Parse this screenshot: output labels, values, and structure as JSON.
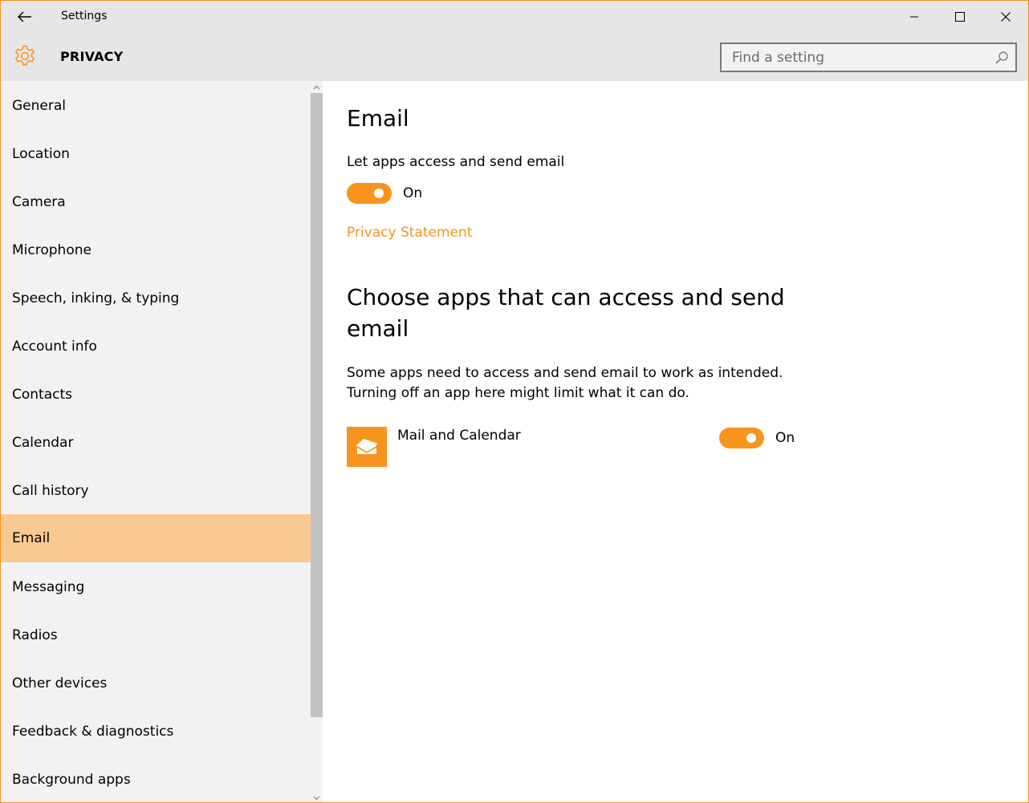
{
  "window": {
    "title": "Settings",
    "border_color": "#f7941d"
  },
  "title_bar": {
    "back_icon": "back-arrow-icon",
    "minimize_icon": "minimize-icon",
    "maximize_icon": "maximize-icon",
    "close_icon": "close-icon"
  },
  "header": {
    "icon": "gear-icon",
    "title": "PRIVACY",
    "search": {
      "placeholder": "Find a setting",
      "value": "",
      "icon": "search-icon"
    }
  },
  "sidebar": {
    "selected_index": 9,
    "items": [
      {
        "label": "General"
      },
      {
        "label": "Location"
      },
      {
        "label": "Camera"
      },
      {
        "label": "Microphone"
      },
      {
        "label": "Speech, inking, & typing"
      },
      {
        "label": "Account info"
      },
      {
        "label": "Contacts"
      },
      {
        "label": "Calendar"
      },
      {
        "label": "Call history"
      },
      {
        "label": "Email"
      },
      {
        "label": "Messaging"
      },
      {
        "label": "Radios"
      },
      {
        "label": "Other devices"
      },
      {
        "label": "Feedback & diagnostics"
      },
      {
        "label": "Background apps"
      }
    ]
  },
  "main": {
    "section_title": "Email",
    "master_toggle": {
      "description": "Let apps access and send email",
      "state_label": "On",
      "is_on": true
    },
    "privacy_link": "Privacy Statement",
    "choose_heading": "Choose apps that can access and send email",
    "choose_description": "Some apps need to access and send email to work as intended. Turning off an app here might limit what it can do.",
    "apps": [
      {
        "name": "Mail and Calendar",
        "icon": "mail-calendar-icon",
        "state_label": "On",
        "is_on": true
      }
    ]
  },
  "colors": {
    "accent": "#f7941d",
    "selected_nav": "#f9c993",
    "chrome_bg": "#e6e6e6",
    "sidebar_bg": "#f2f2f2"
  }
}
